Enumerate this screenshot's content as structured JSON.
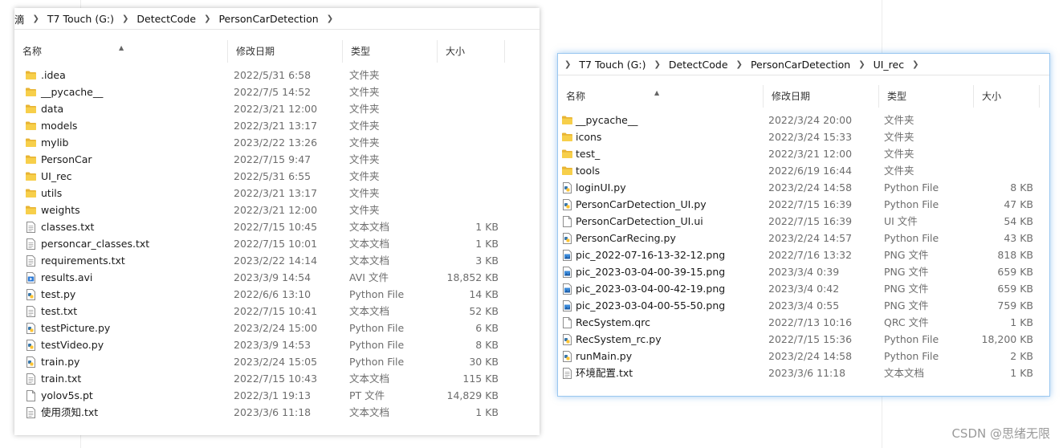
{
  "watermark": "CSDN @思绪无限",
  "left_window": {
    "breadcrumb": [
      "T7 Touch (G:)",
      "DetectCode",
      "PersonCarDetection"
    ],
    "breadcrumb_prefix": "滴",
    "columns": {
      "name": "名称",
      "date": "修改日期",
      "type": "类型",
      "size": "大小"
    },
    "files": [
      {
        "name": ".idea",
        "date": "2022/5/31 6:58",
        "type": "文件夹",
        "size": "",
        "icon": "folder-icon"
      },
      {
        "name": "__pycache__",
        "date": "2022/7/5 14:52",
        "type": "文件夹",
        "size": "",
        "icon": "folder-icon"
      },
      {
        "name": "data",
        "date": "2022/3/21 12:00",
        "type": "文件夹",
        "size": "",
        "icon": "folder-icon"
      },
      {
        "name": "models",
        "date": "2022/3/21 13:17",
        "type": "文件夹",
        "size": "",
        "icon": "folder-icon"
      },
      {
        "name": "mylib",
        "date": "2023/2/22 13:26",
        "type": "文件夹",
        "size": "",
        "icon": "folder-icon"
      },
      {
        "name": "PersonCar",
        "date": "2022/7/15 9:47",
        "type": "文件夹",
        "size": "",
        "icon": "folder-icon"
      },
      {
        "name": "UI_rec",
        "date": "2022/5/31 6:55",
        "type": "文件夹",
        "size": "",
        "icon": "folder-icon"
      },
      {
        "name": "utils",
        "date": "2022/3/21 13:17",
        "type": "文件夹",
        "size": "",
        "icon": "folder-icon"
      },
      {
        "name": "weights",
        "date": "2022/3/21 12:00",
        "type": "文件夹",
        "size": "",
        "icon": "folder-icon"
      },
      {
        "name": "classes.txt",
        "date": "2022/7/15 10:45",
        "type": "文本文档",
        "size": "1 KB",
        "icon": "text-file-icon"
      },
      {
        "name": "personcar_classes.txt",
        "date": "2022/7/15 10:01",
        "type": "文本文档",
        "size": "1 KB",
        "icon": "text-file-icon"
      },
      {
        "name": "requirements.txt",
        "date": "2023/2/22 14:14",
        "type": "文本文档",
        "size": "3 KB",
        "icon": "text-file-icon"
      },
      {
        "name": "results.avi",
        "date": "2023/3/9 14:54",
        "type": "AVI 文件",
        "size": "18,852 KB",
        "icon": "video-file-icon"
      },
      {
        "name": "test.py",
        "date": "2022/6/6 13:10",
        "type": "Python File",
        "size": "14 KB",
        "icon": "python-file-icon"
      },
      {
        "name": "test.txt",
        "date": "2022/7/15 10:41",
        "type": "文本文档",
        "size": "52 KB",
        "icon": "text-file-icon"
      },
      {
        "name": "testPicture.py",
        "date": "2023/2/24 15:00",
        "type": "Python File",
        "size": "6 KB",
        "icon": "python-file-icon"
      },
      {
        "name": "testVideo.py",
        "date": "2023/3/9 14:53",
        "type": "Python File",
        "size": "8 KB",
        "icon": "python-file-icon"
      },
      {
        "name": "train.py",
        "date": "2023/2/24 15:05",
        "type": "Python File",
        "size": "30 KB",
        "icon": "python-file-icon"
      },
      {
        "name": "train.txt",
        "date": "2022/7/15 10:43",
        "type": "文本文档",
        "size": "115 KB",
        "icon": "text-file-icon"
      },
      {
        "name": "yolov5s.pt",
        "date": "2022/3/1 19:13",
        "type": "PT 文件",
        "size": "14,829 KB",
        "icon": "blank-file-icon"
      },
      {
        "name": "使用须知.txt",
        "date": "2023/3/6 11:18",
        "type": "文本文档",
        "size": "1 KB",
        "icon": "text-file-icon"
      }
    ]
  },
  "right_window": {
    "breadcrumb": [
      "T7 Touch (G:)",
      "DetectCode",
      "PersonCarDetection",
      "UI_rec"
    ],
    "columns": {
      "name": "名称",
      "date": "修改日期",
      "type": "类型",
      "size": "大小"
    },
    "files": [
      {
        "name": "__pycache__",
        "date": "2022/3/24 20:00",
        "type": "文件夹",
        "size": "",
        "icon": "folder-icon"
      },
      {
        "name": "icons",
        "date": "2022/3/24 15:33",
        "type": "文件夹",
        "size": "",
        "icon": "folder-icon"
      },
      {
        "name": "test_",
        "date": "2022/3/21 12:00",
        "type": "文件夹",
        "size": "",
        "icon": "folder-icon"
      },
      {
        "name": "tools",
        "date": "2022/6/19 16:44",
        "type": "文件夹",
        "size": "",
        "icon": "folder-icon"
      },
      {
        "name": "loginUI.py",
        "date": "2023/2/24 14:58",
        "type": "Python File",
        "size": "8 KB",
        "icon": "python-file-icon"
      },
      {
        "name": "PersonCarDetection_UI.py",
        "date": "2022/7/15 16:39",
        "type": "Python File",
        "size": "47 KB",
        "icon": "python-file-icon"
      },
      {
        "name": "PersonCarDetection_UI.ui",
        "date": "2022/7/15 16:39",
        "type": "UI 文件",
        "size": "54 KB",
        "icon": "blank-file-icon"
      },
      {
        "name": "PersonCarRecing.py",
        "date": "2023/2/24 14:57",
        "type": "Python File",
        "size": "43 KB",
        "icon": "python-file-icon"
      },
      {
        "name": "pic_2022-07-16-13-32-12.png",
        "date": "2022/7/16 13:32",
        "type": "PNG 文件",
        "size": "818 KB",
        "icon": "image-file-icon"
      },
      {
        "name": "pic_2023-03-04-00-39-15.png",
        "date": "2023/3/4 0:39",
        "type": "PNG 文件",
        "size": "659 KB",
        "icon": "image-file-icon"
      },
      {
        "name": "pic_2023-03-04-00-42-19.png",
        "date": "2023/3/4 0:42",
        "type": "PNG 文件",
        "size": "659 KB",
        "icon": "image-file-icon"
      },
      {
        "name": "pic_2023-03-04-00-55-50.png",
        "date": "2023/3/4 0:55",
        "type": "PNG 文件",
        "size": "759 KB",
        "icon": "image-file-icon"
      },
      {
        "name": "RecSystem.qrc",
        "date": "2022/7/13 10:16",
        "type": "QRC 文件",
        "size": "1 KB",
        "icon": "blank-file-icon"
      },
      {
        "name": "RecSystem_rc.py",
        "date": "2022/7/15 15:36",
        "type": "Python File",
        "size": "18,200 KB",
        "icon": "python-file-icon"
      },
      {
        "name": "runMain.py",
        "date": "2023/2/24 14:58",
        "type": "Python File",
        "size": "2 KB",
        "icon": "python-file-icon"
      },
      {
        "name": "环境配置.txt",
        "date": "2023/3/6 11:18",
        "type": "文本文档",
        "size": "1 KB",
        "icon": "text-file-icon"
      }
    ]
  }
}
